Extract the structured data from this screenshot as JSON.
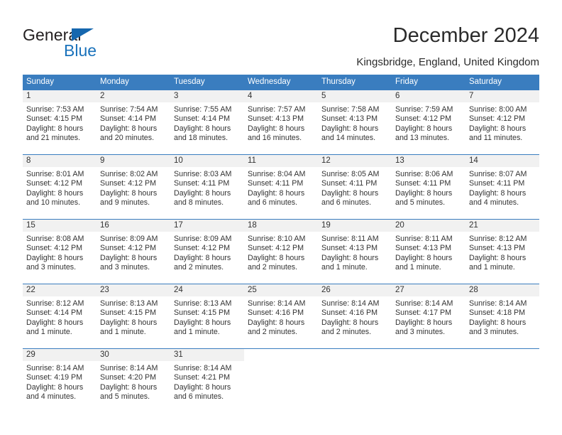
{
  "brand": {
    "name_part1": "General",
    "name_part2": "Blue",
    "triangle_color": "#1667ae",
    "blue_color": "#1a72bb"
  },
  "header": {
    "title": "December 2024",
    "subtitle": "Kingsbridge, England, United Kingdom",
    "accent_color": "#3a7dbf"
  },
  "calendar": {
    "weekday_headers": [
      "Sunday",
      "Monday",
      "Tuesday",
      "Wednesday",
      "Thursday",
      "Friday",
      "Saturday"
    ],
    "weeks": [
      [
        {
          "day": "1",
          "sunrise": "Sunrise: 7:53 AM",
          "sunset": "Sunset: 4:15 PM",
          "daylight1": "Daylight: 8 hours",
          "daylight2": "and 21 minutes."
        },
        {
          "day": "2",
          "sunrise": "Sunrise: 7:54 AM",
          "sunset": "Sunset: 4:14 PM",
          "daylight1": "Daylight: 8 hours",
          "daylight2": "and 20 minutes."
        },
        {
          "day": "3",
          "sunrise": "Sunrise: 7:55 AM",
          "sunset": "Sunset: 4:14 PM",
          "daylight1": "Daylight: 8 hours",
          "daylight2": "and 18 minutes."
        },
        {
          "day": "4",
          "sunrise": "Sunrise: 7:57 AM",
          "sunset": "Sunset: 4:13 PM",
          "daylight1": "Daylight: 8 hours",
          "daylight2": "and 16 minutes."
        },
        {
          "day": "5",
          "sunrise": "Sunrise: 7:58 AM",
          "sunset": "Sunset: 4:13 PM",
          "daylight1": "Daylight: 8 hours",
          "daylight2": "and 14 minutes."
        },
        {
          "day": "6",
          "sunrise": "Sunrise: 7:59 AM",
          "sunset": "Sunset: 4:12 PM",
          "daylight1": "Daylight: 8 hours",
          "daylight2": "and 13 minutes."
        },
        {
          "day": "7",
          "sunrise": "Sunrise: 8:00 AM",
          "sunset": "Sunset: 4:12 PM",
          "daylight1": "Daylight: 8 hours",
          "daylight2": "and 11 minutes."
        }
      ],
      [
        {
          "day": "8",
          "sunrise": "Sunrise: 8:01 AM",
          "sunset": "Sunset: 4:12 PM",
          "daylight1": "Daylight: 8 hours",
          "daylight2": "and 10 minutes."
        },
        {
          "day": "9",
          "sunrise": "Sunrise: 8:02 AM",
          "sunset": "Sunset: 4:12 PM",
          "daylight1": "Daylight: 8 hours",
          "daylight2": "and 9 minutes."
        },
        {
          "day": "10",
          "sunrise": "Sunrise: 8:03 AM",
          "sunset": "Sunset: 4:11 PM",
          "daylight1": "Daylight: 8 hours",
          "daylight2": "and 8 minutes."
        },
        {
          "day": "11",
          "sunrise": "Sunrise: 8:04 AM",
          "sunset": "Sunset: 4:11 PM",
          "daylight1": "Daylight: 8 hours",
          "daylight2": "and 6 minutes."
        },
        {
          "day": "12",
          "sunrise": "Sunrise: 8:05 AM",
          "sunset": "Sunset: 4:11 PM",
          "daylight1": "Daylight: 8 hours",
          "daylight2": "and 6 minutes."
        },
        {
          "day": "13",
          "sunrise": "Sunrise: 8:06 AM",
          "sunset": "Sunset: 4:11 PM",
          "daylight1": "Daylight: 8 hours",
          "daylight2": "and 5 minutes."
        },
        {
          "day": "14",
          "sunrise": "Sunrise: 8:07 AM",
          "sunset": "Sunset: 4:11 PM",
          "daylight1": "Daylight: 8 hours",
          "daylight2": "and 4 minutes."
        }
      ],
      [
        {
          "day": "15",
          "sunrise": "Sunrise: 8:08 AM",
          "sunset": "Sunset: 4:12 PM",
          "daylight1": "Daylight: 8 hours",
          "daylight2": "and 3 minutes."
        },
        {
          "day": "16",
          "sunrise": "Sunrise: 8:09 AM",
          "sunset": "Sunset: 4:12 PM",
          "daylight1": "Daylight: 8 hours",
          "daylight2": "and 3 minutes."
        },
        {
          "day": "17",
          "sunrise": "Sunrise: 8:09 AM",
          "sunset": "Sunset: 4:12 PM",
          "daylight1": "Daylight: 8 hours",
          "daylight2": "and 2 minutes."
        },
        {
          "day": "18",
          "sunrise": "Sunrise: 8:10 AM",
          "sunset": "Sunset: 4:12 PM",
          "daylight1": "Daylight: 8 hours",
          "daylight2": "and 2 minutes."
        },
        {
          "day": "19",
          "sunrise": "Sunrise: 8:11 AM",
          "sunset": "Sunset: 4:13 PM",
          "daylight1": "Daylight: 8 hours",
          "daylight2": "and 1 minute."
        },
        {
          "day": "20",
          "sunrise": "Sunrise: 8:11 AM",
          "sunset": "Sunset: 4:13 PM",
          "daylight1": "Daylight: 8 hours",
          "daylight2": "and 1 minute."
        },
        {
          "day": "21",
          "sunrise": "Sunrise: 8:12 AM",
          "sunset": "Sunset: 4:13 PM",
          "daylight1": "Daylight: 8 hours",
          "daylight2": "and 1 minute."
        }
      ],
      [
        {
          "day": "22",
          "sunrise": "Sunrise: 8:12 AM",
          "sunset": "Sunset: 4:14 PM",
          "daylight1": "Daylight: 8 hours",
          "daylight2": "and 1 minute."
        },
        {
          "day": "23",
          "sunrise": "Sunrise: 8:13 AM",
          "sunset": "Sunset: 4:15 PM",
          "daylight1": "Daylight: 8 hours",
          "daylight2": "and 1 minute."
        },
        {
          "day": "24",
          "sunrise": "Sunrise: 8:13 AM",
          "sunset": "Sunset: 4:15 PM",
          "daylight1": "Daylight: 8 hours",
          "daylight2": "and 1 minute."
        },
        {
          "day": "25",
          "sunrise": "Sunrise: 8:14 AM",
          "sunset": "Sunset: 4:16 PM",
          "daylight1": "Daylight: 8 hours",
          "daylight2": "and 2 minutes."
        },
        {
          "day": "26",
          "sunrise": "Sunrise: 8:14 AM",
          "sunset": "Sunset: 4:16 PM",
          "daylight1": "Daylight: 8 hours",
          "daylight2": "and 2 minutes."
        },
        {
          "day": "27",
          "sunrise": "Sunrise: 8:14 AM",
          "sunset": "Sunset: 4:17 PM",
          "daylight1": "Daylight: 8 hours",
          "daylight2": "and 3 minutes."
        },
        {
          "day": "28",
          "sunrise": "Sunrise: 8:14 AM",
          "sunset": "Sunset: 4:18 PM",
          "daylight1": "Daylight: 8 hours",
          "daylight2": "and 3 minutes."
        }
      ],
      [
        {
          "day": "29",
          "sunrise": "Sunrise: 8:14 AM",
          "sunset": "Sunset: 4:19 PM",
          "daylight1": "Daylight: 8 hours",
          "daylight2": "and 4 minutes."
        },
        {
          "day": "30",
          "sunrise": "Sunrise: 8:14 AM",
          "sunset": "Sunset: 4:20 PM",
          "daylight1": "Daylight: 8 hours",
          "daylight2": "and 5 minutes."
        },
        {
          "day": "31",
          "sunrise": "Sunrise: 8:14 AM",
          "sunset": "Sunset: 4:21 PM",
          "daylight1": "Daylight: 8 hours",
          "daylight2": "and 6 minutes."
        },
        {
          "day": "",
          "sunrise": "",
          "sunset": "",
          "daylight1": "",
          "daylight2": ""
        },
        {
          "day": "",
          "sunrise": "",
          "sunset": "",
          "daylight1": "",
          "daylight2": ""
        },
        {
          "day": "",
          "sunrise": "",
          "sunset": "",
          "daylight1": "",
          "daylight2": ""
        },
        {
          "day": "",
          "sunrise": "",
          "sunset": "",
          "daylight1": "",
          "daylight2": ""
        }
      ]
    ]
  }
}
